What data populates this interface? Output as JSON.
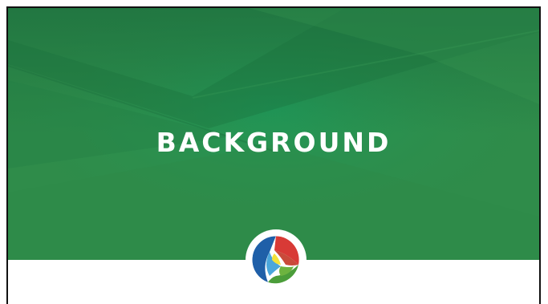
{
  "slide": {
    "title": "BACKGROUND"
  },
  "colors": {
    "banner_green": "#2f8c4a",
    "banner_dark_green": "#1d6b3a",
    "banner_highlight": "#1f9a5a",
    "logo_blue": "#1f5fa8",
    "logo_red": "#d83a36",
    "logo_green": "#6db33f",
    "logo_yellow": "#f2e23a",
    "logo_light_blue": "#4aa6dc"
  },
  "logo": {
    "icon": "tricolor-circle-logo-icon"
  }
}
